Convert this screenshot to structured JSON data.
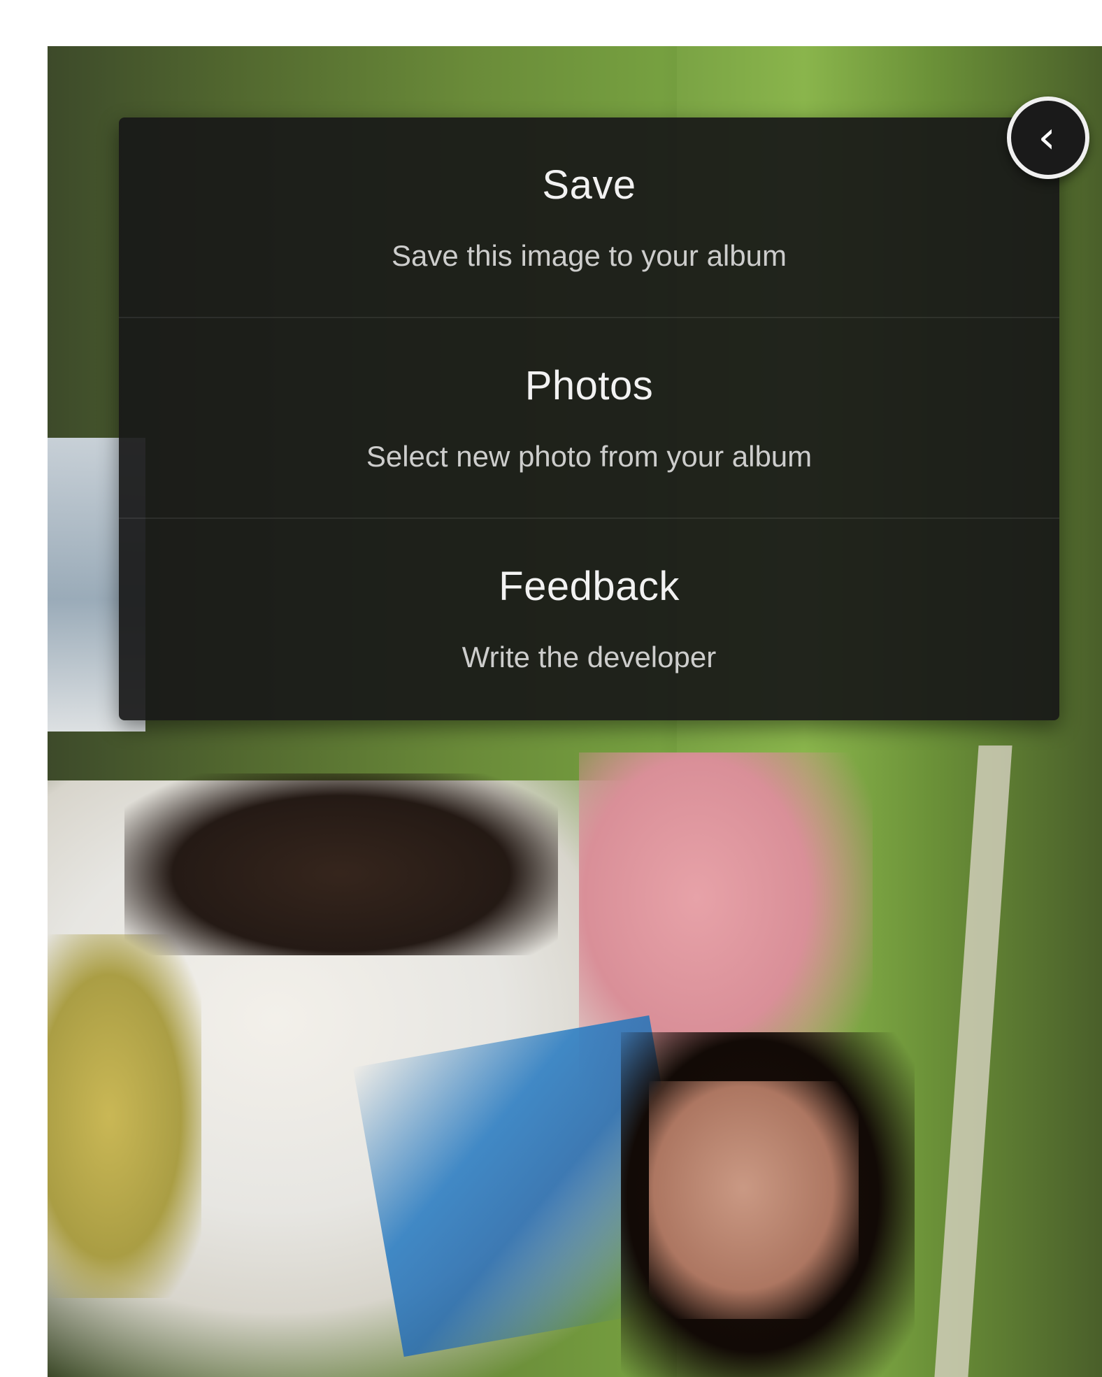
{
  "menu": {
    "items": [
      {
        "title": "Save",
        "subtitle": "Save this image to your album"
      },
      {
        "title": "Photos",
        "subtitle": "Select new photo from your album"
      },
      {
        "title": "Feedback",
        "subtitle": "Write the developer"
      }
    ]
  },
  "close_button": {
    "glyph": "‹",
    "icon": "back-chevron-icon"
  }
}
